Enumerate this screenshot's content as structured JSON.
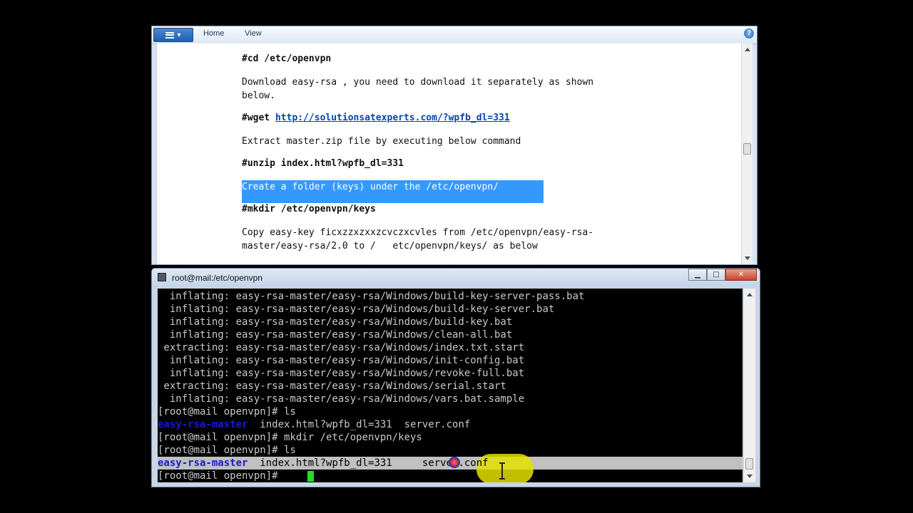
{
  "wordpad": {
    "menu_button_label": "▾",
    "tabs": [
      "Home",
      "View"
    ],
    "help_label": "?",
    "lines": [
      {
        "text": "#cd /etc/openvpn",
        "bold": true
      },
      {
        "text": "Download easy-rsa , you need to download it separately as shown"
      },
      {
        "text": "below."
      },
      {
        "prefix": "#wget ",
        "link": "http://solutionsatexperts.com/?wpfb_dl=331",
        "bold": true
      },
      {
        "text": "Extract master.zip file by executing below command"
      },
      {
        "text": "#unzip index.html?wpfb_dl=331",
        "bold": true
      },
      {
        "text": "Create a folder (keys) under the /etc/openvpn/",
        "selected": true
      },
      {
        "text": "#mkdir /etc/openvpn/keys",
        "bold": true
      },
      {
        "text": "Copy easy-key ficxzzxzxxzcvczxcvles from /etc/openvpn/easy-rsa-"
      },
      {
        "text": "master/easy-rsa/2.0 to /   etc/openvpn/keys/ as below"
      }
    ]
  },
  "putty": {
    "title": "root@mail:/etc/openvpn",
    "controls": {
      "minimize": "▁",
      "maximize": "□",
      "close": "✕"
    },
    "lines": [
      "  inflating: easy-rsa-master/easy-rsa/Windows/build-key-server-pass.bat",
      "  inflating: easy-rsa-master/easy-rsa/Windows/build-key-server.bat",
      "  inflating: easy-rsa-master/easy-rsa/Windows/build-key.bat",
      "  inflating: easy-rsa-master/easy-rsa/Windows/clean-all.bat",
      " extracting: easy-rsa-master/easy-rsa/Windows/index.txt.start",
      "  inflating: easy-rsa-master/easy-rsa/Windows/init-config.bat",
      "  inflating: easy-rsa-master/easy-rsa/Windows/revoke-full.bat",
      " extracting: easy-rsa-master/easy-rsa/Windows/serial.start",
      "  inflating: easy-rsa-master/easy-rsa/Windows/vars.bat.sample",
      "[root@mail openvpn]# ls"
    ],
    "ls1": {
      "dir": "easy-rsa-master",
      "rest": "  index.html?wpfb_dl=331  server.conf"
    },
    "cmd_mkdir": "[root@mail openvpn]# mkdir /etc/openvpn/keys",
    "cmd_ls2": "[root@mail openvpn]# ls",
    "ls2": {
      "dir": "easy-rsa-master",
      "rest": "  index.html?wpfb_dl=331     server.conf"
    },
    "prompt": "[root@mail openvpn]# "
  },
  "colors": {
    "selection": "#3399ff",
    "terminal_dir": "#1a1acc",
    "cursor": "#22dd22",
    "highlight": "#e3e000"
  }
}
